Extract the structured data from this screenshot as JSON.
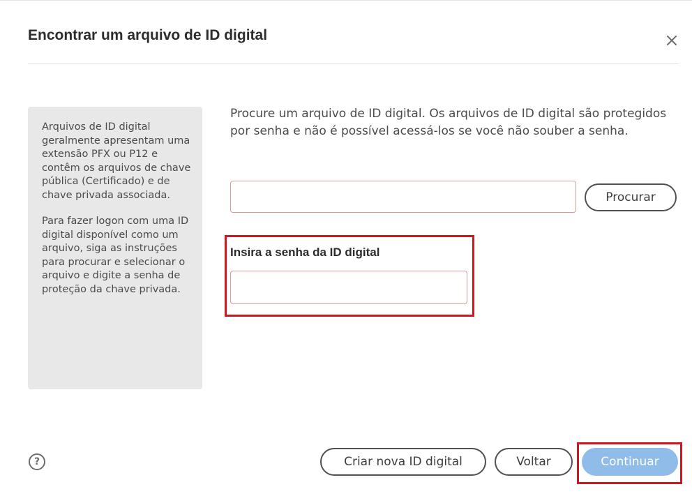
{
  "dialog": {
    "title": "Encontrar um arquivo de ID digital",
    "close_icon": "close-icon"
  },
  "info_panel": {
    "paragraph_1": "Arquivos de ID digital geralmente apresentam uma extensão PFX ou P12 e contêm os arquivos de chave pública (Certificado) e de chave privada associada.",
    "paragraph_2": "Para fazer logon com uma ID digital disponível como um arquivo, siga as instruções para procurar e selecionar o arquivo e digite a senha de proteção da chave privada."
  },
  "main": {
    "description": "Procure um arquivo de ID digital. Os arquivos de ID digital são protegidos por senha e não é possível acessá-los se você não souber a senha.",
    "file_input": {
      "value": "",
      "placeholder": ""
    },
    "browse_label": "Procurar",
    "password_label": "Insira a senha da ID digital",
    "password_input": {
      "value": "",
      "placeholder": ""
    }
  },
  "footer": {
    "help_icon": "help-icon",
    "help_glyph": "?",
    "create_label": "Criar nova ID digital",
    "back_label": "Voltar",
    "continue_label": "Continuar"
  },
  "colors": {
    "primary_button": "#90bcea",
    "highlight": "#d0161f",
    "panel_background": "#e8e8e8",
    "input_border": "#d89a9a"
  }
}
